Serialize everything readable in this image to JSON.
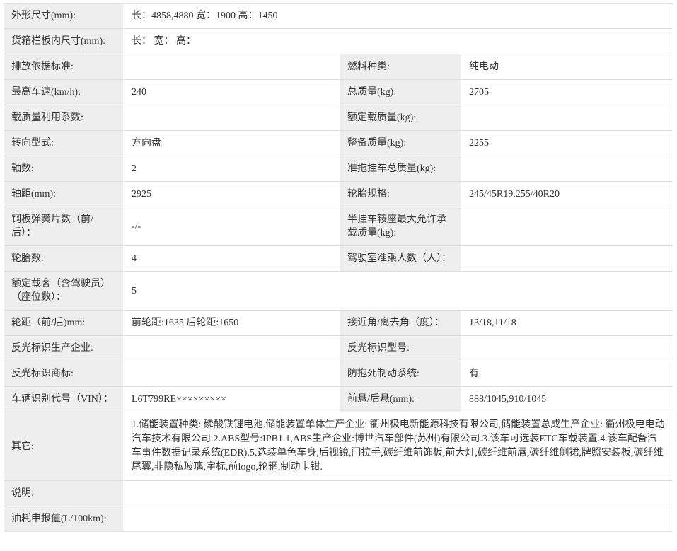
{
  "table": {
    "colors": {
      "label_bg": "#eeeeee",
      "border": "#dcdcdc",
      "text": "#333333",
      "value_bg": "#ffffff"
    },
    "rows": [
      {
        "cells": [
          {
            "label": "外形尺寸(mm):",
            "value": "长：4858,4880 宽：1900 高：1450",
            "span": 3
          }
        ]
      },
      {
        "cells": [
          {
            "label": "货箱栏板内尺寸(mm):",
            "value": "长：  宽：  高：",
            "span": 3
          }
        ]
      },
      {
        "cells": [
          {
            "label": "排放依据标准:",
            "value": ""
          },
          {
            "label": "燃料种类:",
            "value": "纯电动"
          }
        ]
      },
      {
        "cells": [
          {
            "label": "最高车速(km/h):",
            "value": "240"
          },
          {
            "label": "总质量(kg):",
            "value": "2705"
          }
        ]
      },
      {
        "cells": [
          {
            "label": "载质量利用系数:",
            "value": ""
          },
          {
            "label": "额定载质量(kg):",
            "value": ""
          }
        ]
      },
      {
        "cells": [
          {
            "label": "转向型式:",
            "value": "方向盘"
          },
          {
            "label": "整备质量(kg):",
            "value": "2255"
          }
        ]
      },
      {
        "cells": [
          {
            "label": "轴数:",
            "value": "2"
          },
          {
            "label": "准拖挂车总质量(kg):",
            "value": ""
          }
        ]
      },
      {
        "cells": [
          {
            "label": "轴距(mm):",
            "value": "2925"
          },
          {
            "label": "轮胎规格:",
            "value": "245/45R19,255/40R20"
          }
        ]
      },
      {
        "cells": [
          {
            "label": "钢板弹簧片数（前/后）：",
            "value": "-/-"
          },
          {
            "label": "半挂车鞍座最大允许承载质量(kg):",
            "value": ""
          }
        ]
      },
      {
        "cells": [
          {
            "label": "轮胎数:",
            "value": "4"
          },
          {
            "label": "驾驶室准乘人数（人）：",
            "value": ""
          }
        ]
      },
      {
        "cells": [
          {
            "label": "额定载客（含驾驶员）（座位数）：",
            "value": "5",
            "span": 3
          }
        ]
      },
      {
        "cells": [
          {
            "label": "轮距（前/后)mm:",
            "value": "前轮距:1635 后轮距:1650"
          },
          {
            "label": "接近角/离去角（度）：",
            "value": "13/18,11/18"
          }
        ]
      },
      {
        "cells": [
          {
            "label": "反光标识生产企业:",
            "value": ""
          },
          {
            "label": "反光标识型号:",
            "value": ""
          }
        ]
      },
      {
        "cells": [
          {
            "label": "反光标识商标:",
            "value": ""
          },
          {
            "label": "防抱死制动系统:",
            "value": "有"
          }
        ]
      },
      {
        "cells": [
          {
            "label": "车辆识别代号（VIN）：",
            "value": "L6T799RE×××××××××"
          },
          {
            "label": "前悬/后悬(mm):",
            "value": "888/1045,910/1045"
          }
        ]
      },
      {
        "cells": [
          {
            "label": "其它:",
            "value": "1.储能装置种类: 磷酸铁锂电池.储能装置单体生产企业: 衢州极电新能源科技有限公司,储能装置总成生产企业: 衢州极电电动汽车技术有限公司.2.ABS型号:IPB1.1,ABS生产企业:博世汽车部件(苏州)有限公司.3.该车可选装ETC车载装置.4.该车配备汽车事件数据记录系统(EDR).5.选装单色车身,后视镜,门拉手,碳纤维前饰板,前大灯,碳纤维前唇,碳纤维侧裙,牌照安装板,碳纤维尾翼,非隐私玻璃,字标,前logo,轮辋,制动卡钳.",
            "span": 3,
            "long": true
          }
        ]
      },
      {
        "cells": [
          {
            "label": "说明:",
            "value": "",
            "span": 3
          }
        ]
      },
      {
        "cells": [
          {
            "label": "油耗申报值(L/100km):",
            "value": "",
            "span": 3
          }
        ]
      }
    ]
  }
}
